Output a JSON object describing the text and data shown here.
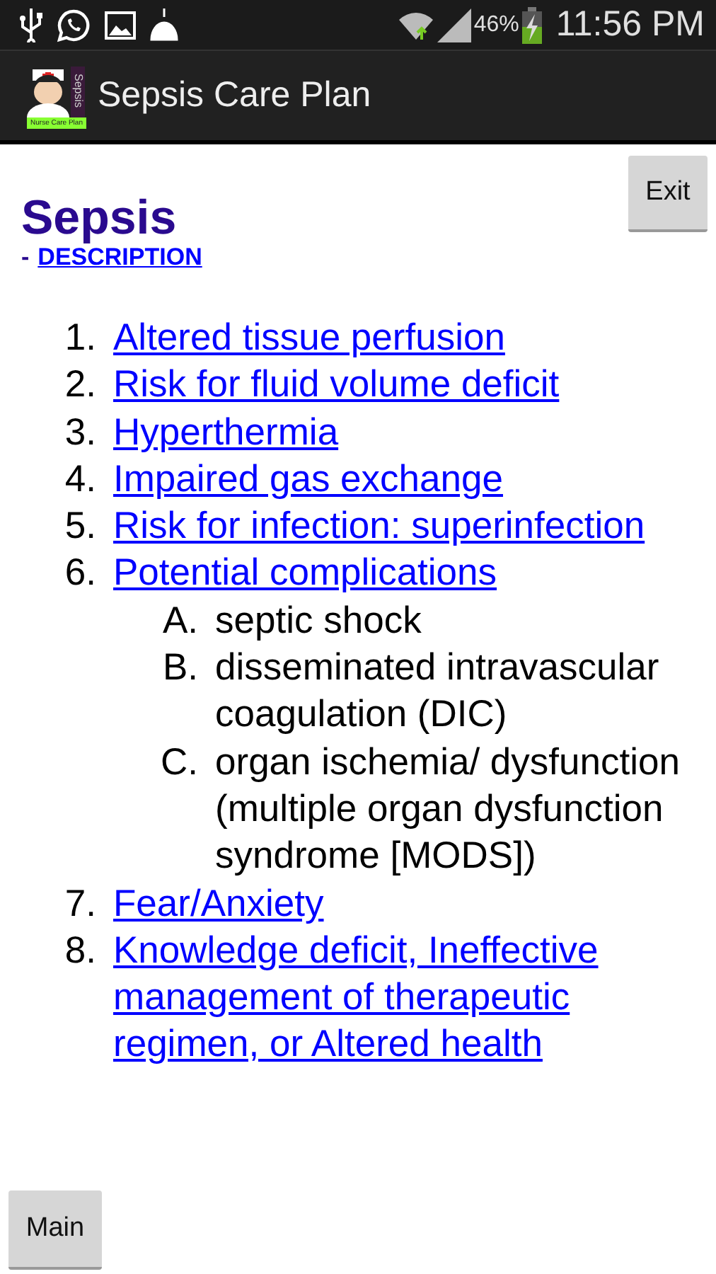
{
  "status_bar": {
    "battery": "46%",
    "time": "11:56 PM"
  },
  "app_bar": {
    "logo": {
      "side_text": "Sepsis",
      "bottom_text": "Nurse Care Plan"
    },
    "title": "Sepsis Care Plan"
  },
  "page": {
    "title": "Sepsis",
    "description_prefix": "-",
    "description_link": "DESCRIPTION",
    "exit_button": "Exit"
  },
  "items": [
    {
      "number": "1.",
      "label": "Altered tissue perfusion",
      "kind": "link"
    },
    {
      "number": "2.",
      "label": "Risk for fluid volume deficit",
      "kind": "link"
    },
    {
      "number": "3.",
      "label": "Hyperthermia",
      "kind": "link"
    },
    {
      "number": "4.",
      "label": "Impaired gas exchange",
      "kind": "link"
    },
    {
      "number": "5.",
      "label": "Risk for infection: superinfection",
      "kind": "link"
    },
    {
      "number": "6.",
      "label": "Potential complications",
      "kind": "link",
      "children": [
        {
          "number": "A.",
          "label": "septic shock",
          "kind": "text"
        },
        {
          "number": "B.",
          "label": "disseminated intravascular coagulation (DIC)",
          "kind": "text"
        },
        {
          "number": "C.",
          "label": "organ ischemia/ dysfunction (multiple organ dysfunction syndrome [MODS])",
          "kind": "text"
        }
      ]
    },
    {
      "number": "7.",
      "label": "Fear/Anxiety",
      "kind": "link"
    },
    {
      "number": "8.",
      "label": "Knowledge deficit, Ineffective management of therapeutic regimen, or Altered health",
      "kind": "link"
    }
  ],
  "main_button": "Main"
}
